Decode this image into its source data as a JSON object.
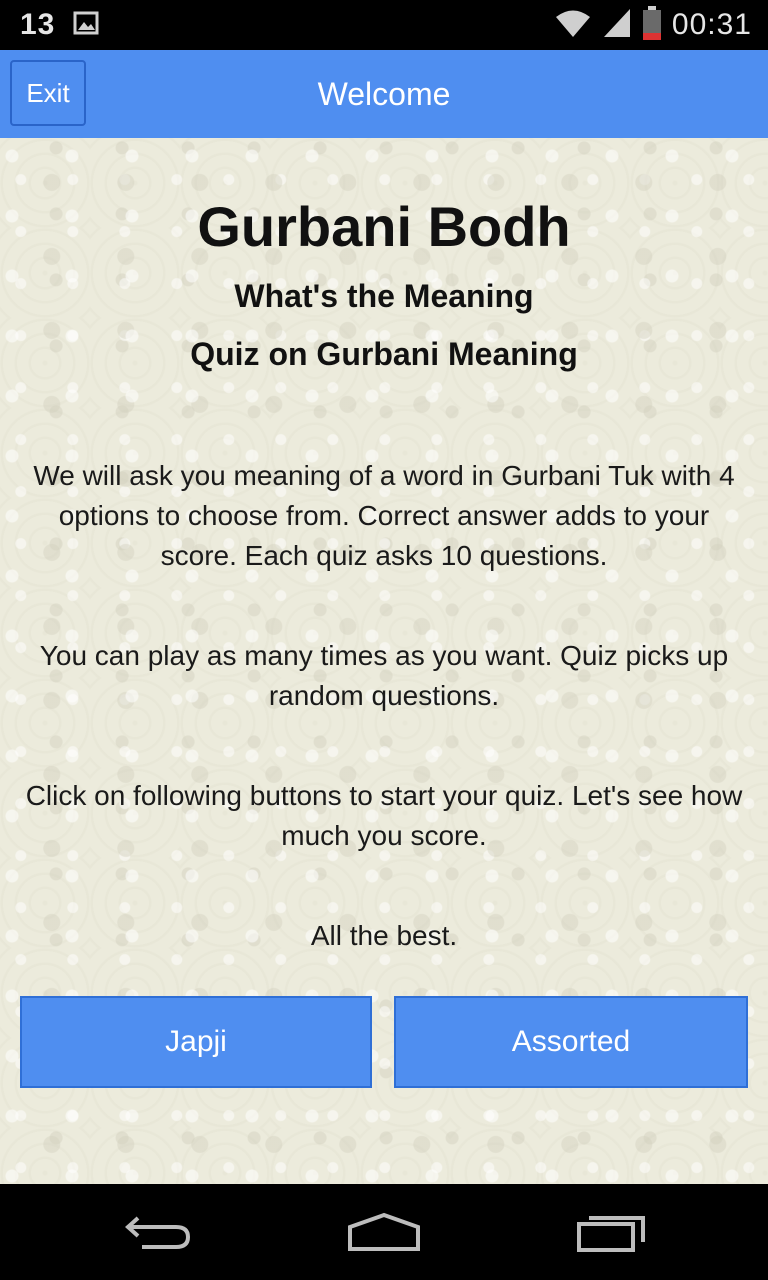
{
  "status_bar": {
    "notification_count": "13",
    "time": "00:31",
    "icons": [
      "image-icon",
      "wifi-icon",
      "signal-icon",
      "battery-icon"
    ]
  },
  "title_bar": {
    "exit_label": "Exit",
    "title": "Welcome",
    "accent_color": "#4f8ef0"
  },
  "main": {
    "app_title": "Gurbani Bodh",
    "subtitle1": "What's the Meaning",
    "subtitle2": "Quiz on Gurbani Meaning",
    "paragraph1": "We will ask you meaning of a word in Gurbani Tuk with 4 options to choose from. Correct answer adds to your score. Each quiz asks 10 questions.",
    "paragraph2": "You can play as many times as you want. Quiz picks up random questions.",
    "paragraph3": "Click on following buttons to start your quiz. Let's see how much you score.",
    "paragraph4": "All the best.",
    "buttons": {
      "japji": "Japji",
      "assorted": "Assorted"
    }
  },
  "nav_bar": {
    "icons": [
      "back-icon",
      "home-icon",
      "recent-apps-icon"
    ]
  }
}
